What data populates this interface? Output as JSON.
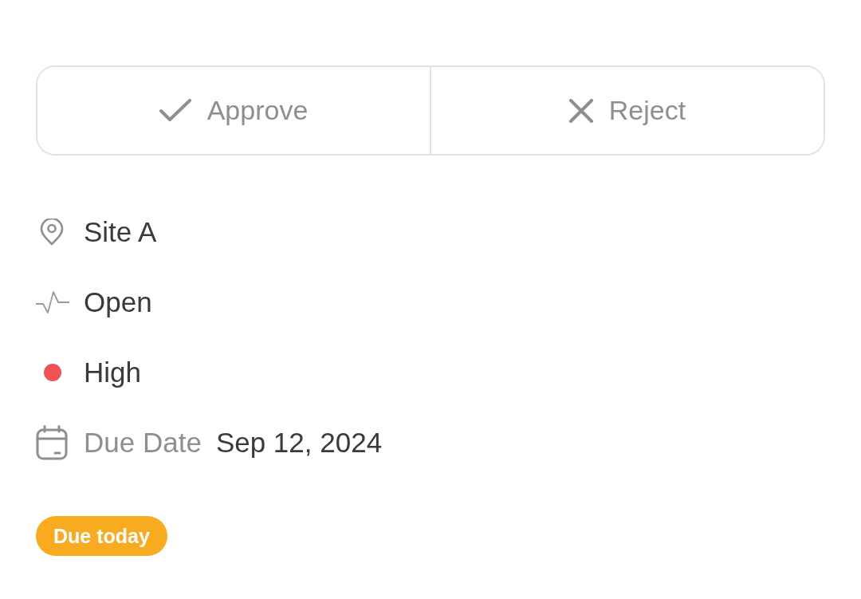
{
  "actions": [
    {
      "kind": "approve",
      "label": "Approve"
    },
    {
      "kind": "reject",
      "label": "Reject"
    }
  ],
  "details": [
    {
      "kind": "location",
      "value": "Site A"
    },
    {
      "kind": "status",
      "value": "Open"
    },
    {
      "kind": "priority",
      "value": "High",
      "color": "#f25253"
    },
    {
      "kind": "due_date",
      "label": "Due Date",
      "value": "Sep 12, 2024"
    }
  ],
  "badge": {
    "label": "Due today"
  }
}
